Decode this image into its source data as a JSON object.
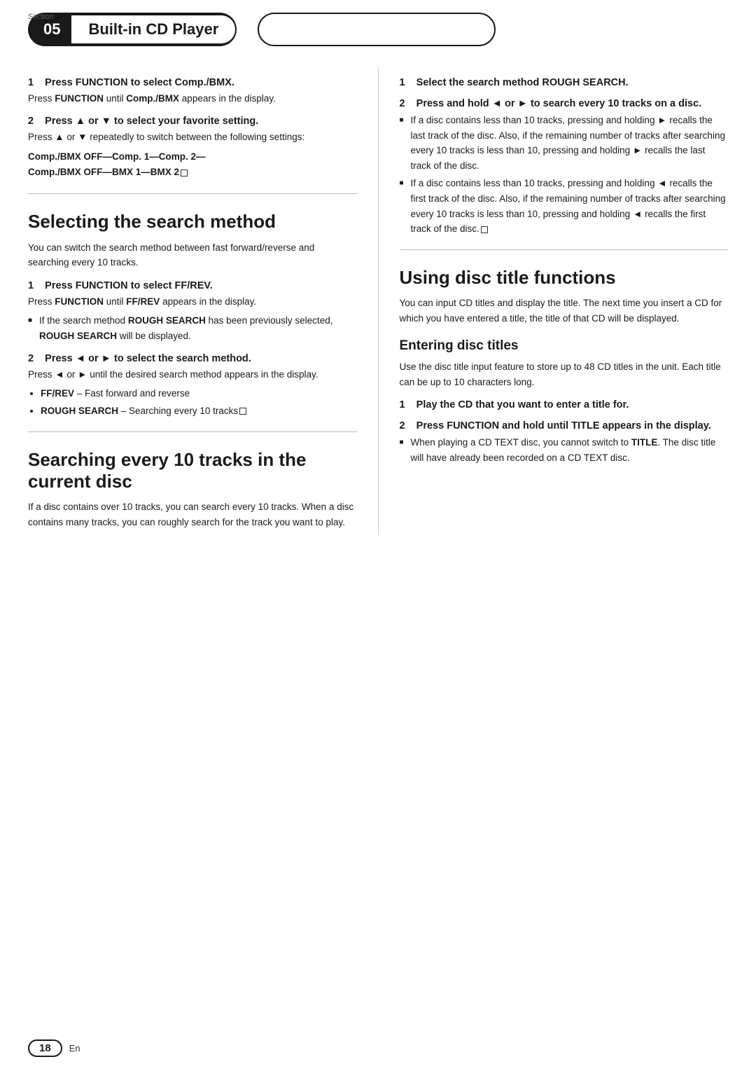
{
  "header": {
    "section_label": "Section",
    "section_number": "05",
    "section_title": "Built-in CD Player",
    "right_box": ""
  },
  "footer": {
    "page_number": "18",
    "lang": "En"
  },
  "left_col": {
    "step1_compbmx": {
      "heading": "1    Press FUNCTION to select Comp./BMX.",
      "body": "Press FUNCTION until Comp./BMX appears in the display."
    },
    "step2_fav": {
      "heading": "2    Press ▲ or ▼ to select your favorite setting.",
      "body": "Press ▲ or ▼ repeatedly to switch between the following settings:",
      "code": "Comp./BMX OFF—Comp. 1—Comp. 2—\nComp./BMX OFF—BMX 1—BMX 2"
    },
    "selecting_search_method": {
      "heading": "Selecting the search method",
      "intro": "You can switch the search method between fast forward/reverse and searching every 10 tracks."
    },
    "step1_ffrev": {
      "heading": "1    Press FUNCTION to select FF/REV.",
      "body": "Press FUNCTION until FF/REV appears in the display.",
      "note": "If the search method ROUGH SEARCH has been previously selected, ROUGH SEARCH will be displayed."
    },
    "step2_searchmethod": {
      "heading": "2    Press ◄ or ► to select the search method.",
      "body": "Press ◄ or ► until the desired search method appears in the display.",
      "bullets": [
        {
          "label": "FF/REV",
          "text": " – Fast forward and reverse"
        },
        {
          "label": "ROUGH SEARCH",
          "text": " – Searching every 10 tracks"
        }
      ]
    },
    "searching_section": {
      "heading": "Searching every 10 tracks in the current disc",
      "intro": "If a disc contains over 10 tracks, you can search every 10 tracks. When a disc contains many tracks, you can roughly search for the track you want to play."
    }
  },
  "right_col": {
    "step1_rough": {
      "heading": "1    Select the search method ROUGH SEARCH."
    },
    "step2_presshold": {
      "heading": "2    Press and hold ◄ or ► to search every 10 tracks on a disc.",
      "bullets": [
        "If a disc contains less than 10 tracks, pressing and holding ► recalls the last track of the disc. Also, if the remaining number of tracks after searching every 10 tracks is less than 10, pressing and holding ► recalls the last track of the disc.",
        "If a disc contains less than 10 tracks, pressing and holding ◄ recalls the first track of the disc. Also, if the remaining number of tracks after searching every 10 tracks is less than 10, pressing and holding ◄ recalls the first track of the disc."
      ]
    },
    "using_disc_title": {
      "heading": "Using disc title functions",
      "intro": "You can input CD titles and display the title. The next time you insert a CD for which you have entered a title, the title of that CD will be displayed."
    },
    "entering_disc_titles": {
      "subheading": "Entering disc titles",
      "intro": "Use the disc title input feature to store up to 48 CD titles in the unit. Each title can be up to 10 characters long."
    },
    "step1_play": {
      "heading": "1    Play the CD that you want to enter a title for."
    },
    "step2_title": {
      "heading": "2    Press FUNCTION and hold until TITLE appears in the display.",
      "bullet": "When playing a CD TEXT disc, you cannot switch to TITLE. The disc title will have already been recorded on a CD TEXT disc."
    }
  }
}
